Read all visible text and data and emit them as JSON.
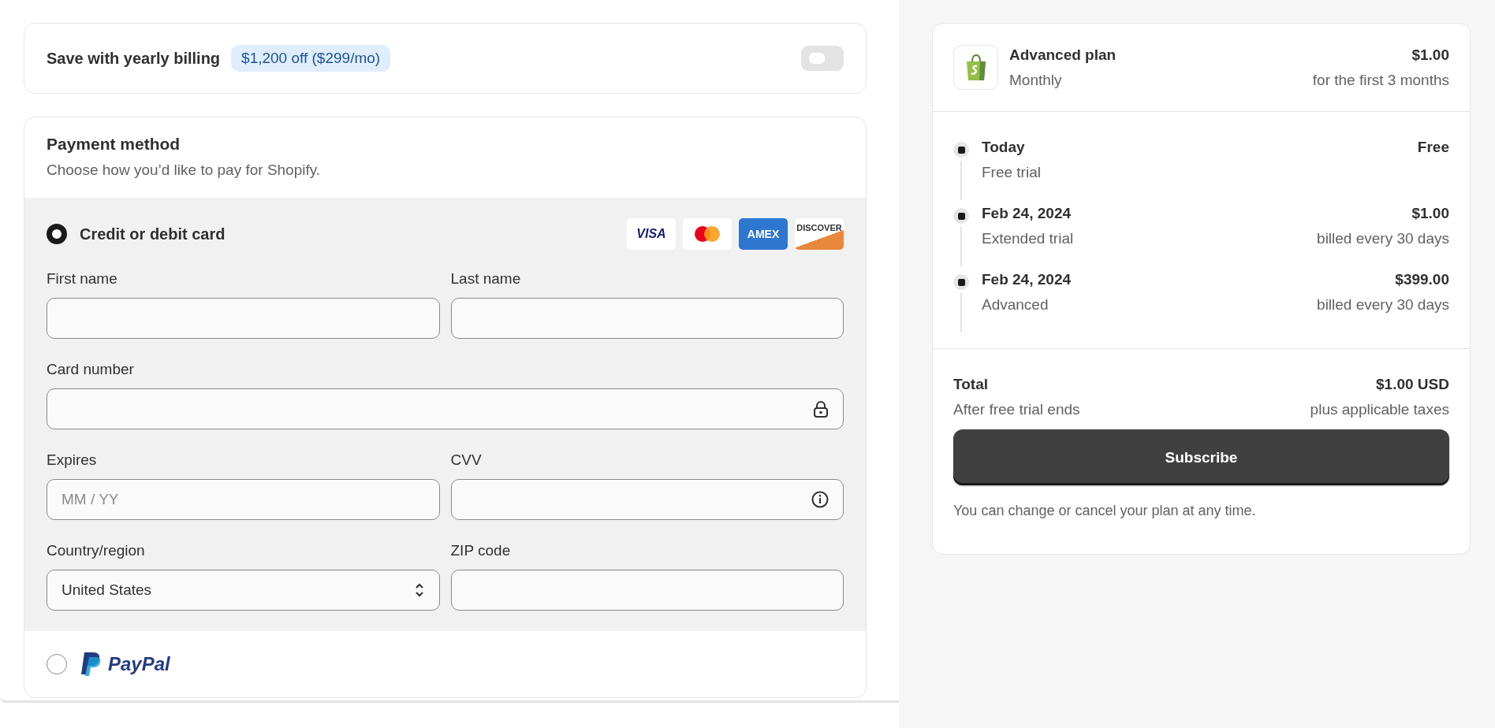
{
  "yearly_billing": {
    "label": "Save with yearly billing",
    "badge": "$1,200 off ($299/mo)",
    "on": false
  },
  "payment_method": {
    "title": "Payment method",
    "subtitle": "Choose how you’d like to pay for Shopify.",
    "options": [
      {
        "kind": "card",
        "label": "Credit or debit card",
        "selected": true,
        "brands": [
          {
            "kind": "visa",
            "text": "VISA"
          },
          {
            "kind": "mastercard"
          },
          {
            "kind": "amex",
            "text": "AMEX"
          },
          {
            "kind": "discover",
            "text": "DISCOVER"
          }
        ]
      },
      {
        "kind": "paypal",
        "label": "PayPal",
        "selected": false
      }
    ],
    "fields": [
      {
        "kind": "text",
        "label": "First name"
      },
      {
        "kind": "text",
        "label": "Last name"
      },
      {
        "kind": "lock",
        "label": "Card number"
      },
      {
        "kind": "text",
        "label": "Expires",
        "placeholder": "MM / YY"
      },
      {
        "kind": "info",
        "label": "CVV"
      },
      {
        "kind": "select",
        "label": "Country/region",
        "value": "United States"
      },
      {
        "kind": "text",
        "label": "ZIP code"
      }
    ]
  },
  "summary": {
    "plan": {
      "name": "Advanced plan",
      "period": "Monthly",
      "price": "$1.00",
      "price_note": "for the first 3 months"
    },
    "timeline": [
      {
        "date": "Today",
        "desc": "Free trial",
        "amount": "Free"
      },
      {
        "date": "Feb 24, 2024",
        "desc": "Extended trial",
        "amount": "$1.00",
        "note": "billed every 30 days"
      },
      {
        "date": "Feb 24, 2024",
        "desc": "Advanced",
        "amount": "$399.00",
        "note": "billed every 30 days"
      }
    ],
    "total": {
      "label": "Total",
      "sublabel": "After free trial ends",
      "amount": "$1.00 USD",
      "note": "plus applicable taxes"
    },
    "button": "Subscribe",
    "footnote": "You can change or cancel your plan at any time."
  }
}
